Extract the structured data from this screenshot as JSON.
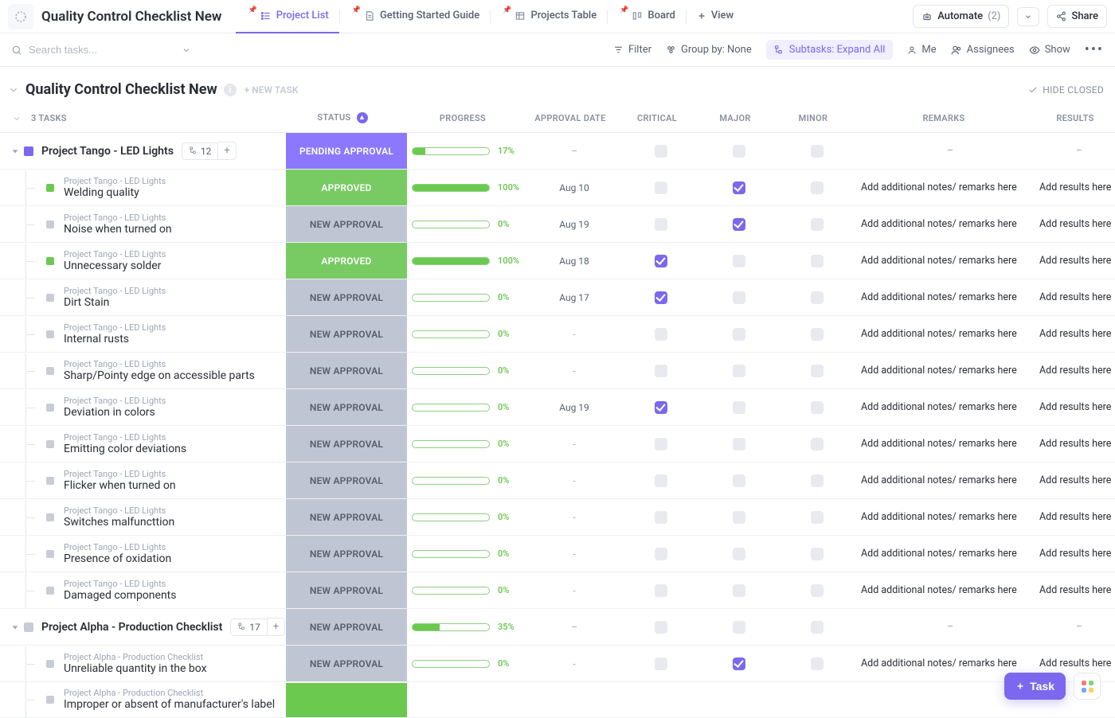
{
  "header": {
    "title": "Quality Control Checklist New",
    "tabs": [
      {
        "label": "Project List",
        "active": true
      },
      {
        "label": "Getting Started Guide",
        "active": false
      },
      {
        "label": "Projects Table",
        "active": false
      },
      {
        "label": "Board",
        "active": false
      }
    ],
    "add_view": "View",
    "automate_label": "Automate",
    "automate_count": "(2)",
    "share_label": "Share"
  },
  "toolbar": {
    "search_placeholder": "Search tasks...",
    "filter": "Filter",
    "groupby": "Group by: None",
    "subtasks": "Subtasks: Expand All",
    "me": "Me",
    "assignees": "Assignees",
    "show": "Show"
  },
  "section": {
    "title": "Quality Control Checklist New",
    "new_task": "+ NEW TASK",
    "hide_closed": "HIDE CLOSED",
    "task_count": "3 TASKS"
  },
  "columns": {
    "status": "STATUS",
    "progress": "PROGRESS",
    "approval_date": "APPROVAL DATE",
    "critical": "CRITICAL",
    "major": "MAJOR",
    "minor": "MINOR",
    "remarks": "REMARKS",
    "results": "RESULTS"
  },
  "common": {
    "remarks_text": "Add additional notes/ remarks here",
    "results_text": "Add results here",
    "dash": "–"
  },
  "groups": [
    {
      "title": "Project Tango - LED Lights",
      "chip": "purple",
      "sub_count": "12",
      "status": {
        "text": "PENDING APPROVAL",
        "class": "st-pending"
      },
      "progress": 17,
      "date": "–",
      "critical": false,
      "major": false,
      "minor": false,
      "remarks": "–",
      "results": "–",
      "parent": "Project Tango - LED Lights",
      "subs": [
        {
          "name": "Welding quality",
          "chip": "green",
          "status": {
            "text": "APPROVED",
            "class": "st-approved"
          },
          "progress": 100,
          "date": "Aug 10",
          "critical": false,
          "major": true,
          "minor": false
        },
        {
          "name": "Noise when turned on",
          "chip": "grey",
          "status": {
            "text": "NEW APPROVAL",
            "class": "st-new"
          },
          "progress": 0,
          "date": "Aug 19",
          "critical": false,
          "major": true,
          "minor": false
        },
        {
          "name": "Unnecessary solder",
          "chip": "green",
          "status": {
            "text": "APPROVED",
            "class": "st-approved"
          },
          "progress": 100,
          "date": "Aug 18",
          "critical": true,
          "major": false,
          "minor": false
        },
        {
          "name": "Dirt Stain",
          "chip": "grey",
          "status": {
            "text": "NEW APPROVAL",
            "class": "st-new"
          },
          "progress": 0,
          "date": "Aug 17",
          "critical": true,
          "major": false,
          "minor": false
        },
        {
          "name": "Internal rusts",
          "chip": "grey",
          "status": {
            "text": "NEW APPROVAL",
            "class": "st-new"
          },
          "progress": 0,
          "date": "–",
          "critical": false,
          "major": false,
          "minor": false
        },
        {
          "name": "Sharp/Pointy edge on accessible parts",
          "chip": "grey",
          "status": {
            "text": "NEW APPROVAL",
            "class": "st-new"
          },
          "progress": 0,
          "date": "–",
          "critical": false,
          "major": false,
          "minor": false
        },
        {
          "name": "Deviation in colors",
          "chip": "grey",
          "status": {
            "text": "NEW APPROVAL",
            "class": "st-new"
          },
          "progress": 0,
          "date": "Aug 19",
          "critical": true,
          "major": false,
          "minor": false
        },
        {
          "name": "Emitting color deviations",
          "chip": "grey",
          "status": {
            "text": "NEW APPROVAL",
            "class": "st-new"
          },
          "progress": 0,
          "date": "–",
          "critical": false,
          "major": false,
          "minor": false
        },
        {
          "name": "Flicker when turned on",
          "chip": "grey",
          "status": {
            "text": "NEW APPROVAL",
            "class": "st-new"
          },
          "progress": 0,
          "date": "–",
          "critical": false,
          "major": false,
          "minor": false
        },
        {
          "name": "Switches malfuncttion",
          "chip": "grey",
          "status": {
            "text": "NEW APPROVAL",
            "class": "st-new"
          },
          "progress": 0,
          "date": "–",
          "critical": false,
          "major": false,
          "minor": false
        },
        {
          "name": "Presence of oxidation",
          "chip": "grey",
          "status": {
            "text": "NEW APPROVAL",
            "class": "st-new"
          },
          "progress": 0,
          "date": "–",
          "critical": false,
          "major": false,
          "minor": false
        },
        {
          "name": "Damaged components",
          "chip": "grey",
          "status": {
            "text": "NEW APPROVAL",
            "class": "st-new"
          },
          "progress": 0,
          "date": "–",
          "critical": false,
          "major": false,
          "minor": false
        }
      ]
    },
    {
      "title": "Project Alpha - Production Checklist",
      "chip": "grey",
      "sub_count": "17",
      "status": {
        "text": "NEW APPROVAL",
        "class": "st-new"
      },
      "progress": 35,
      "date": "–",
      "critical": false,
      "major": false,
      "minor": false,
      "remarks": "–",
      "results": "–",
      "parent": "Project Alpha - Production Checklist",
      "subs": [
        {
          "name": "Unreliable quantity in the box",
          "chip": "grey",
          "status": {
            "text": "NEW APPROVAL",
            "class": "st-new"
          },
          "progress": 0,
          "date": "–",
          "critical": false,
          "major": true,
          "minor": false
        },
        {
          "name": "Improper or absent of manufacturer's label",
          "chip": "grey",
          "status": {
            "text": "",
            "class": "st-green-big"
          },
          "progress": null,
          "date": "",
          "critical": null,
          "major": null,
          "minor": null
        }
      ]
    }
  ],
  "fab": {
    "task": "Task"
  }
}
